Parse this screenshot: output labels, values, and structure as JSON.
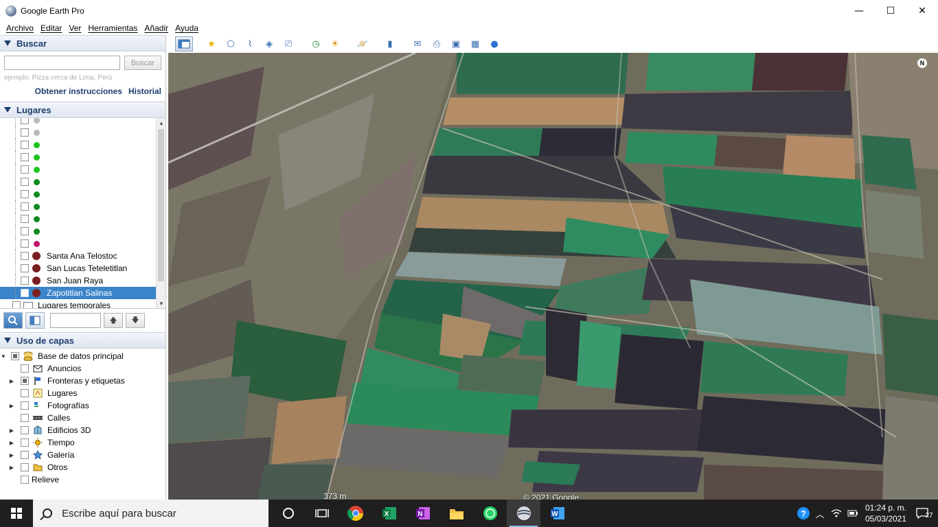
{
  "window": {
    "title": "Google Earth Pro",
    "controls": {
      "minimize": "—",
      "maximize": "☐",
      "close": "✕"
    }
  },
  "menu": [
    "Archivo",
    "Editar",
    "Ver",
    "Herramientas",
    "Añadir",
    "Ayuda"
  ],
  "search": {
    "header": "Buscar",
    "input_value": "",
    "button": "Buscar",
    "hint": "ejemplo: Pizza cerca de Lima, Perú",
    "links": [
      "Obtener instrucciones",
      "Historial"
    ]
  },
  "places": {
    "header": "Lugares",
    "items": [
      {
        "label": "",
        "color": "#b9b9b9",
        "big": false
      },
      {
        "label": "",
        "color": "#b9b9b9",
        "big": false
      },
      {
        "label": "",
        "color": "#1fc31f",
        "big": false
      },
      {
        "label": "",
        "color": "#1fc31f",
        "big": false
      },
      {
        "label": "",
        "color": "#1fc31f",
        "big": false
      },
      {
        "label": "",
        "color": "#0e8a1e",
        "big": false
      },
      {
        "label": "",
        "color": "#0e8a1e",
        "big": false
      },
      {
        "label": "",
        "color": "#0e8a1e",
        "big": false
      },
      {
        "label": "",
        "color": "#0e8a1e",
        "big": false
      },
      {
        "label": "",
        "color": "#0e8a1e",
        "big": false
      },
      {
        "label": "",
        "color": "#c0136e",
        "big": false
      },
      {
        "label": "Santa Ana Telostoc",
        "color": "#7a1f1f",
        "big": true
      },
      {
        "label": "San Lucas Teteletitlan",
        "color": "#7a1f1f",
        "big": true
      },
      {
        "label": "San Juan Raya",
        "color": "#7a1f1f",
        "big": true
      },
      {
        "label": "Zapotitlan Salinas",
        "color": "#7a1f1f",
        "big": true,
        "selected": true
      }
    ],
    "temp_folder": "Lugares temporales"
  },
  "layers": {
    "header": "Uso de capas",
    "items": [
      {
        "label": "Base de datos principal",
        "icon": "database-icon",
        "expander": "▼",
        "level": 0,
        "partial": true
      },
      {
        "label": "Anuncios",
        "icon": "envelope-icon",
        "expander": "",
        "level": 1
      },
      {
        "label": "Fronteras y etiquetas",
        "icon": "flag-icon",
        "expander": "▶",
        "level": 1,
        "partial": true
      },
      {
        "label": "Lugares",
        "icon": "places-icon",
        "expander": "",
        "level": 1
      },
      {
        "label": "Fotografías",
        "icon": "photo-icon",
        "expander": "▶",
        "level": 1
      },
      {
        "label": "Calles",
        "icon": "road-icon",
        "expander": "",
        "level": 1
      },
      {
        "label": "Edificios 3D",
        "icon": "building-icon",
        "expander": "▶",
        "level": 1
      },
      {
        "label": "Tiempo",
        "icon": "sun-icon",
        "expander": "▶",
        "level": 1
      },
      {
        "label": "Galería",
        "icon": "star-icon",
        "expander": "▶",
        "level": 1
      },
      {
        "label": "Otros",
        "icon": "folder-icon",
        "expander": "▶",
        "level": 1
      },
      {
        "label": "Relieve",
        "icon": "",
        "expander": "",
        "level": 0
      }
    ]
  },
  "map": {
    "scale": "373 m",
    "copyright": "© 2021 Google",
    "north": "N"
  },
  "taskbar": {
    "search_placeholder": "Escribe aquí para buscar",
    "time": "01:24 p. m.",
    "date": "05/03/2021",
    "notifications": "27"
  }
}
